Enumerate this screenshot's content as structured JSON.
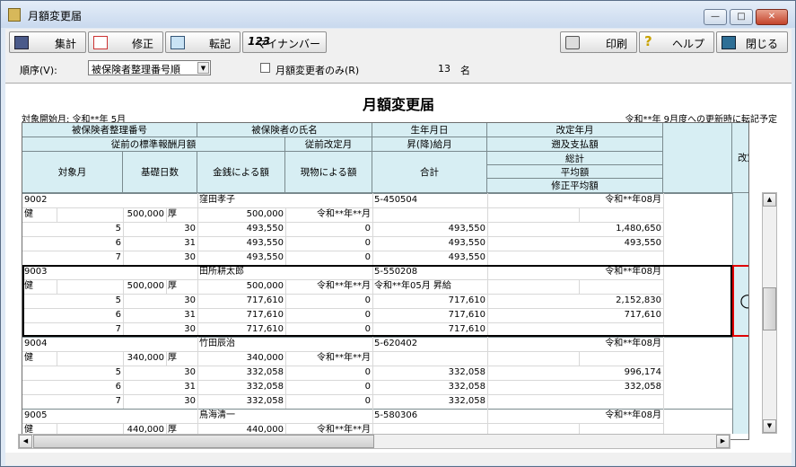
{
  "window": {
    "title": "月額変更届",
    "min_btn": "—",
    "max_btn": "□",
    "close_btn": "✕"
  },
  "toolbar": {
    "sum": "集計",
    "edit": "修正",
    "transfer": "転記",
    "mynumber": "マイナンバー",
    "mynumber_prefix": "123",
    "print": "印刷",
    "help": "ヘルプ",
    "close": "閉じる"
  },
  "options": {
    "order_label": "順序(V):",
    "order_value": "被保険者整理番号順",
    "only_changed_label": "月額変更者のみ(R)",
    "count": "13",
    "count_unit": "名"
  },
  "doc": {
    "title": "月額変更届",
    "start_label": "対象開始月: 令和**年 5月",
    "note": "令和**年 9月度への更新時に転記予定"
  },
  "headers": {
    "insured_no": "被保険者整理番号",
    "name": "被保険者の氏名",
    "birth": "生年月日",
    "revised_month": "改定年月",
    "prev_std": "従前の標準報酬月額",
    "prev_revised": "従前改定月",
    "raise": "昇(降)給月",
    "retro": "遡及支払額",
    "target_month": "対象月",
    "base_days": "基礎日数",
    "cash": "金銭による額",
    "in_kind": "現物による額",
    "total": "合計",
    "grand_total": "総計",
    "average": "平均額",
    "corrected_avg": "修正平均額",
    "kaitei": "改定"
  },
  "records": [
    {
      "no": "9002",
      "name": "窪田孝子",
      "birth": "5-450504",
      "rev": "令和**年08月",
      "kind": "健",
      "std": "500,000",
      "kind2": "厚",
      "std2": "500,000",
      "prev_rev": "令和**年**月",
      "raise": "",
      "rows": [
        [
          "5",
          "30",
          "493,550",
          "0",
          "493,550"
        ],
        [
          "6",
          "31",
          "493,550",
          "0",
          "493,550"
        ],
        [
          "7",
          "30",
          "493,550",
          "0",
          "493,550"
        ]
      ],
      "grand_total": "1,480,650",
      "average": "493,550",
      "kaitei": ""
    },
    {
      "no": "9003",
      "name": "田所耕太郎",
      "birth": "5-550208",
      "rev": "令和**年08月",
      "kind": "健",
      "std": "500,000",
      "kind2": "厚",
      "std2": "500,000",
      "prev_rev": "令和**年**月",
      "raise": "令和**年05月 昇給",
      "rows": [
        [
          "5",
          "30",
          "717,610",
          "0",
          "717,610"
        ],
        [
          "6",
          "31",
          "717,610",
          "0",
          "717,610"
        ],
        [
          "7",
          "30",
          "717,610",
          "0",
          "717,610"
        ]
      ],
      "grand_total": "2,152,830",
      "average": "717,610",
      "kaitei": "○"
    },
    {
      "no": "9004",
      "name": "竹田辰治",
      "birth": "5-620402",
      "rev": "令和**年08月",
      "kind": "健",
      "std": "340,000",
      "kind2": "厚",
      "std2": "340,000",
      "prev_rev": "令和**年**月",
      "raise": "",
      "rows": [
        [
          "5",
          "30",
          "332,058",
          "0",
          "332,058"
        ],
        [
          "6",
          "31",
          "332,058",
          "0",
          "332,058"
        ],
        [
          "7",
          "30",
          "332,058",
          "0",
          "332,058"
        ]
      ],
      "grand_total": "996,174",
      "average": "332,058",
      "kaitei": ""
    },
    {
      "no": "9005",
      "name": "鳥海清一",
      "birth": "5-580306",
      "rev": "令和**年08月",
      "kind": "健",
      "std": "440,000",
      "kind2": "厚",
      "std2": "440,000",
      "prev_rev": "令和**年**月",
      "raise": "",
      "rows": [],
      "grand_total": "",
      "average": "",
      "kaitei": ""
    }
  ]
}
